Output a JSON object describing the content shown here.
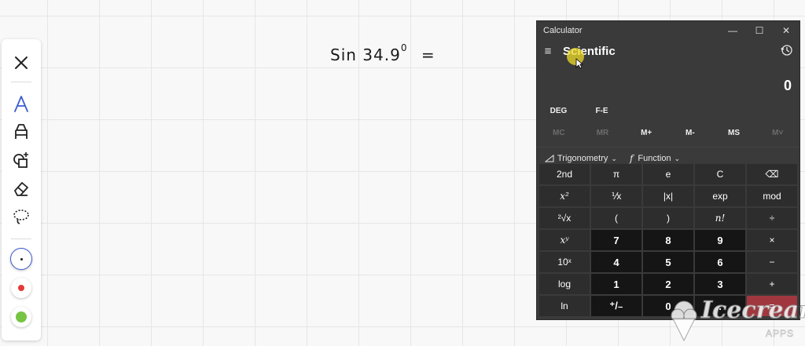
{
  "toolbar": {
    "items": [
      "close-icon",
      "pen-icon",
      "highlighter-icon",
      "shapes-icon",
      "eraser-icon",
      "lasso-icon"
    ],
    "colors": {
      "black_pen": "#1a1a1a",
      "red": "#e53935",
      "green": "#76c442",
      "accent": "#3b5ccc"
    }
  },
  "handwriting": {
    "text": "Sin 34.9",
    "degree": "0",
    "equals": "="
  },
  "calculator": {
    "title": "Calculator",
    "mode": "Scientific",
    "display": "0",
    "deg": "DEG",
    "fe": "F-E",
    "memory": [
      "MC",
      "MR",
      "M+",
      "M-",
      "MS",
      "M˅"
    ],
    "trig_label": "Trigonometry",
    "function_label": "Function",
    "keys": [
      [
        "2nd",
        "π",
        "e",
        "C",
        "⌫"
      ],
      [
        "x²",
        "⅟x",
        "|x|",
        "exp",
        "mod"
      ],
      [
        "²√x",
        "(",
        ")",
        "n!",
        "÷"
      ],
      [
        "xʸ",
        "7",
        "8",
        "9",
        "×"
      ],
      [
        "10ˣ",
        "4",
        "5",
        "6",
        "−"
      ],
      [
        "log",
        "1",
        "2",
        "3",
        "+"
      ],
      [
        "ln",
        "⁺/₋",
        "0",
        ".",
        "="
      ]
    ]
  },
  "watermark": {
    "brand": "Icecream",
    "sub": "APPS"
  }
}
